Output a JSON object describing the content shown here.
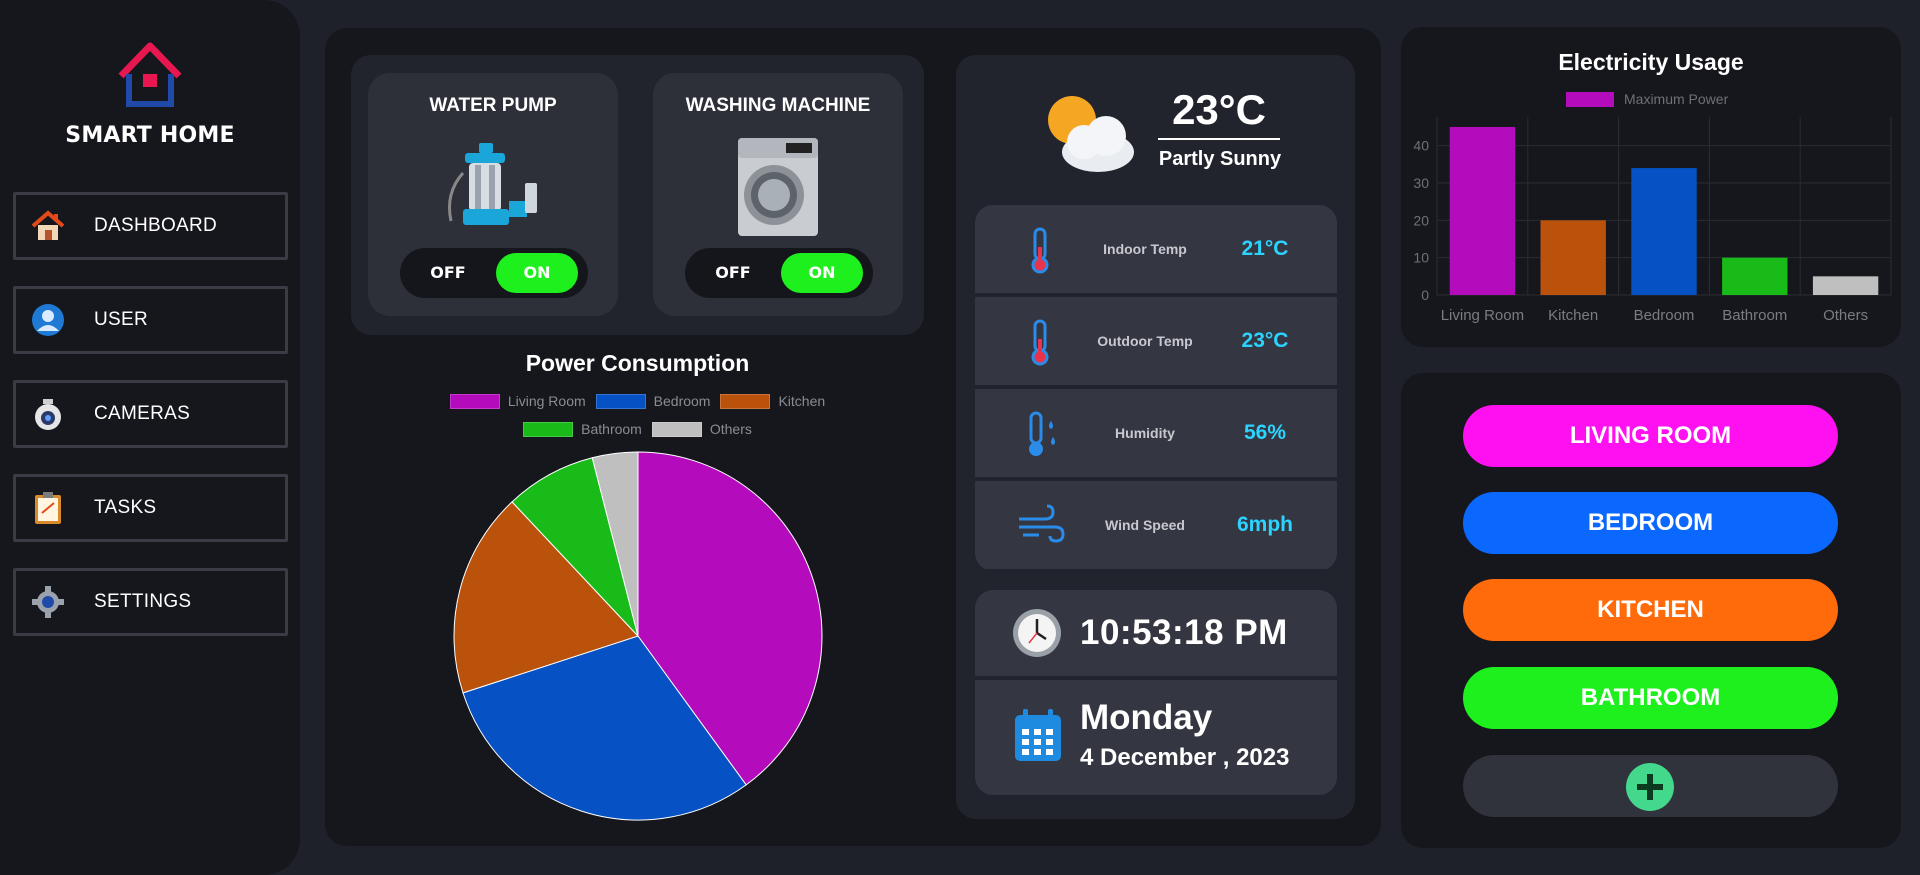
{
  "sidebar": {
    "brand": "SMART HOME",
    "items": [
      {
        "label": "DASHBOARD",
        "icon": "house-icon"
      },
      {
        "label": "USER",
        "icon": "user-icon"
      },
      {
        "label": "CAMERAS",
        "icon": "camera-icon"
      },
      {
        "label": "TASKS",
        "icon": "clipboard-icon"
      },
      {
        "label": "SETTINGS",
        "icon": "gear-icon"
      }
    ]
  },
  "devices": [
    {
      "title": "WATER PUMP",
      "icon": "water-pump-icon",
      "off_label": "OFF",
      "on_label": "ON",
      "state": "on"
    },
    {
      "title": "WASHING MACHINE",
      "icon": "washing-machine-icon",
      "off_label": "OFF",
      "on_label": "ON",
      "state": "on"
    }
  ],
  "weather": {
    "icon": "partly-sunny-icon",
    "temperature": "23°C",
    "description": "Partly Sunny",
    "stats": [
      {
        "label": "Indoor Temp",
        "value": "21°C",
        "icon": "thermometer-icon"
      },
      {
        "label": "Outdoor Temp",
        "value": "23°C",
        "icon": "thermometer-icon"
      },
      {
        "label": "Humidity",
        "value": "56%",
        "icon": "humidity-icon"
      },
      {
        "label": "Wind Speed",
        "value": "6mph",
        "icon": "wind-icon"
      }
    ],
    "accent": "#2bd4ff"
  },
  "clock": {
    "time": "10:53:18 PM",
    "day": "Monday",
    "date": "4 December , 2023"
  },
  "rooms": [
    {
      "label": "LIVING ROOM",
      "color": "#ff10f0"
    },
    {
      "label": "BEDROOM",
      "color": "#0a68ff"
    },
    {
      "label": "KITCHEN",
      "color": "#ff6a0a"
    },
    {
      "label": "BATHROOM",
      "color": "#1ef01e"
    }
  ],
  "add_room_icon": "plus-icon",
  "chart_data": [
    {
      "type": "pie",
      "title": "Power Consumption",
      "labels": [
        "Living Room",
        "Bedroom",
        "Kitchen",
        "Bathroom",
        "Others"
      ],
      "values": [
        40,
        30,
        18,
        8,
        4
      ],
      "colors": [
        "#b40bbd",
        "#0652c4",
        "#bb520c",
        "#19bb19",
        "#bfbfbf"
      ],
      "legend": "top"
    },
    {
      "type": "bar",
      "title": "Electricity Usage",
      "categories": [
        "Living Room",
        "Kitchen",
        "Bedroom",
        "Bathroom",
        "Others"
      ],
      "series": [
        {
          "name": "Maximum Power",
          "values": [
            45,
            20,
            34,
            10,
            5
          ]
        }
      ],
      "colors": [
        "#b40bbd",
        "#bb520c",
        "#0652c4",
        "#19bb19",
        "#bfbfbf"
      ],
      "legend_color": "#b40bbd",
      "yticks": [
        0,
        10,
        20,
        30,
        40
      ],
      "ylim": [
        0,
        45
      ],
      "grid": true,
      "legend": "top"
    }
  ]
}
